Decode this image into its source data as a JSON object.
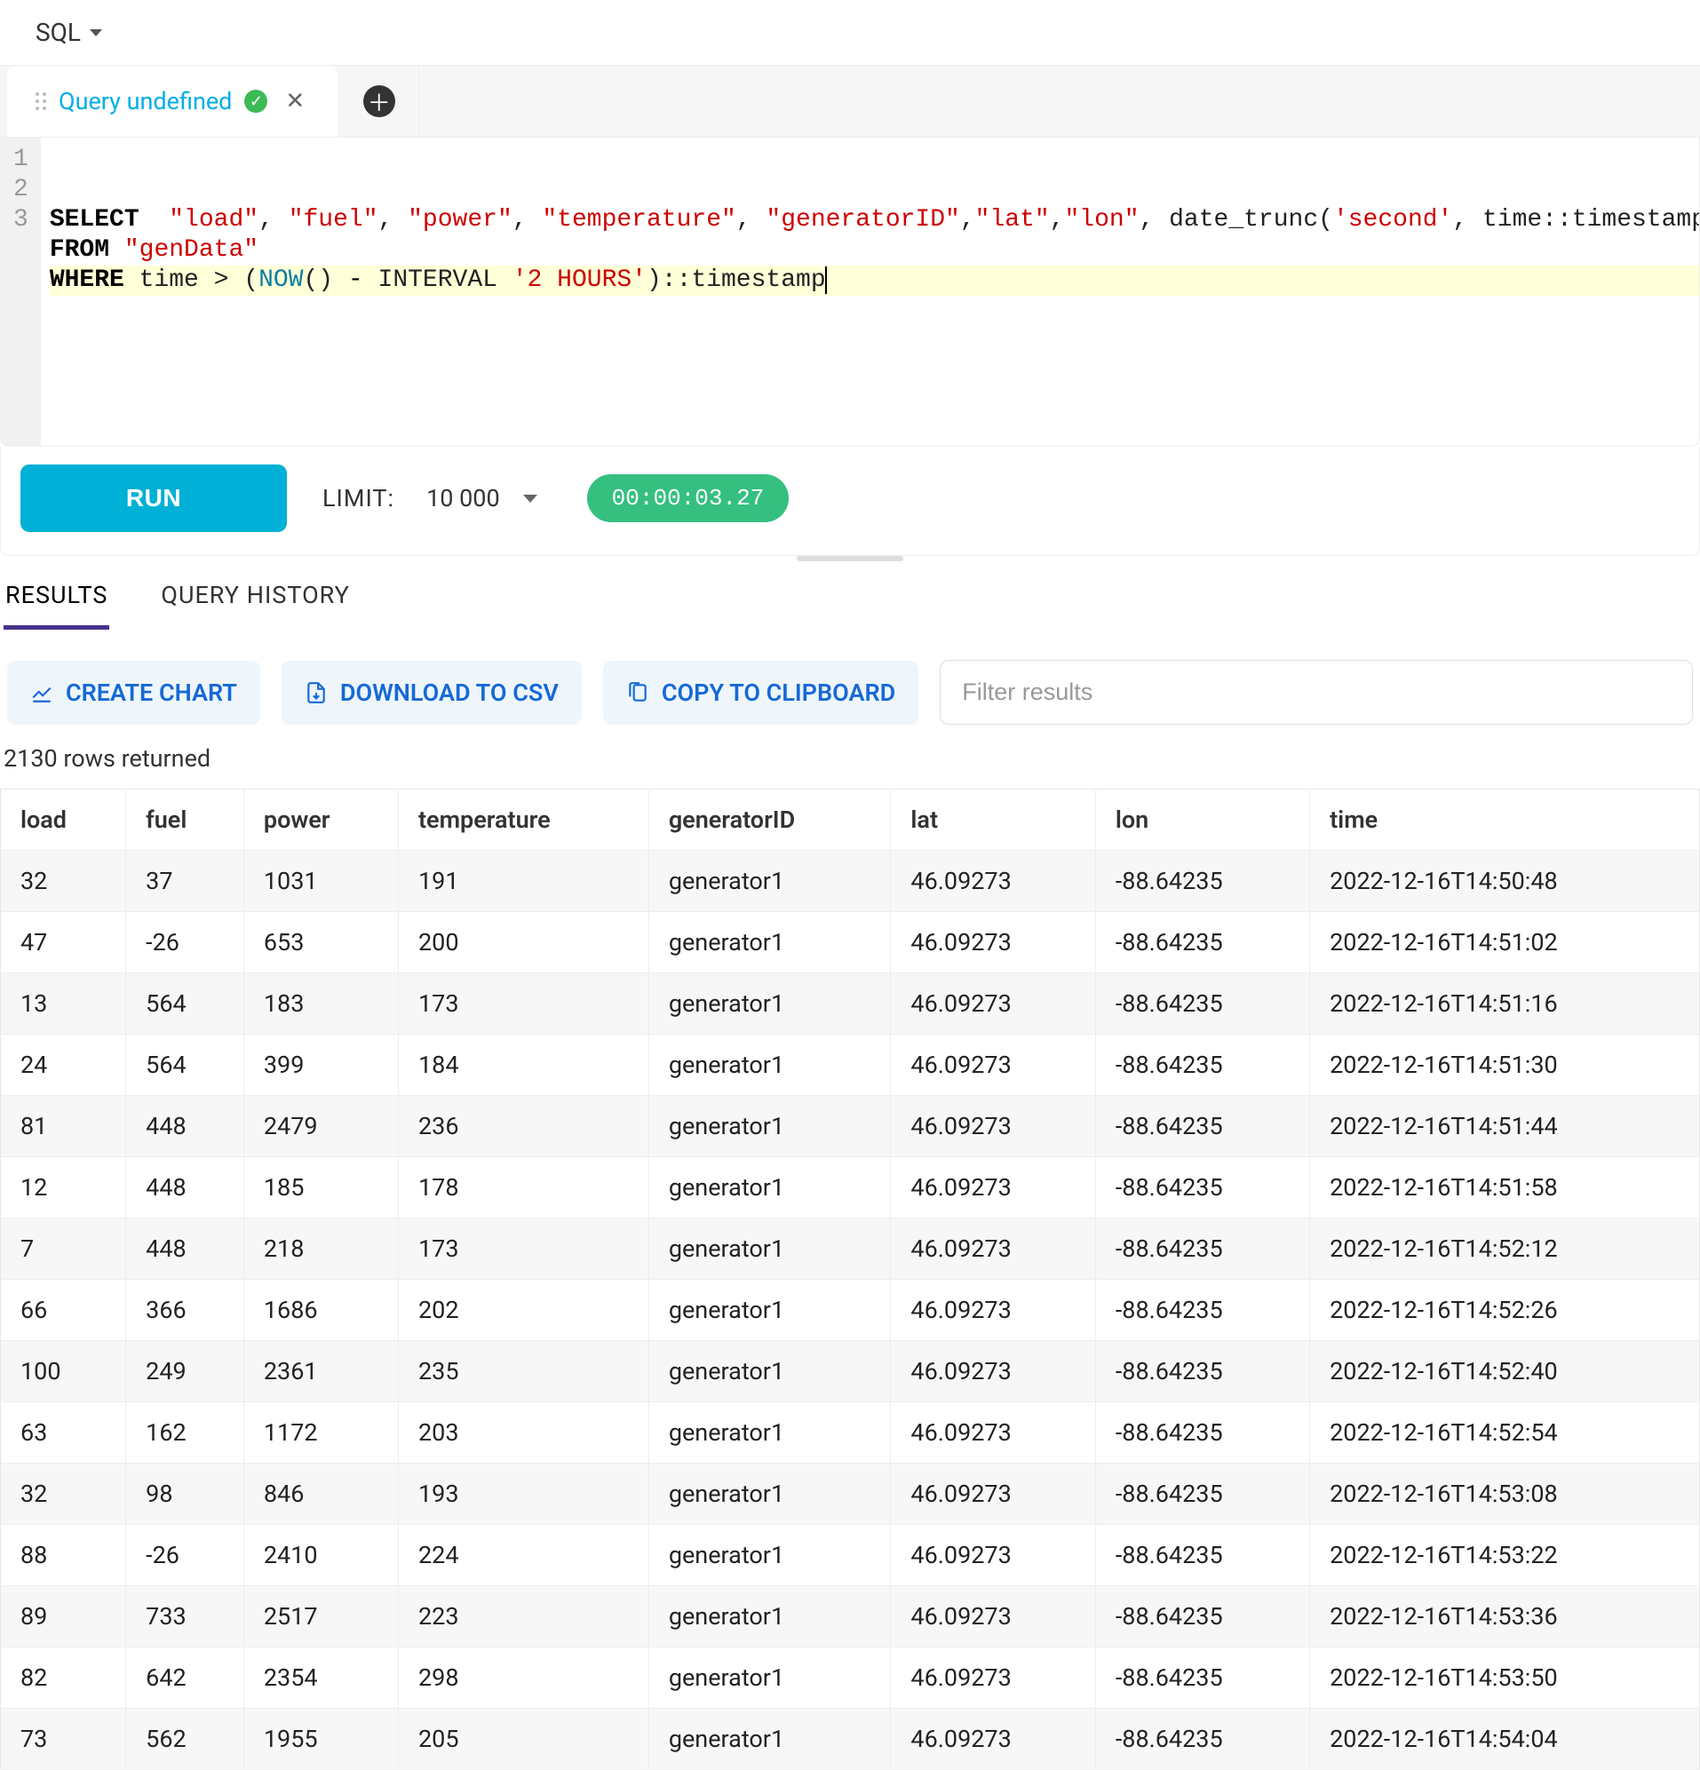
{
  "topbar": {
    "language": "SQL"
  },
  "tab": {
    "title": "Query undefined"
  },
  "editor": {
    "line_numbers": [
      "1",
      "2",
      "3"
    ],
    "lines_html": [
      "<span class='kw'>SELECT</span>  <span class='str'>\"load\"</span>, <span class='str'>\"fuel\"</span>, <span class='str'>\"power\"</span>, <span class='str'>\"temperature\"</span>, <span class='str'>\"generatorID\"</span>,<span class='str'>\"lat\"</span>,<span class='str'>\"lon\"</span>, date_trunc(<span class='lit'>'second'</span>, time::timestamp) <span class='kw'>as</span> <span class='str'>\"time\"</span>",
      "<span class='kw'>FROM</span> <span class='str'>\"genData\"</span>",
      "<span class='kw'>WHERE</span> time &gt; (<span class='fn'>NOW</span>() <span class='op'>-</span> INTERVAL <span class='lit'>'2 HOURS'</span>)::timestamp<span class='cursor'></span>"
    ],
    "highlighted_line_index": 2
  },
  "controls": {
    "run_label": "RUN",
    "limit_label": "LIMIT:",
    "limit_value": "10 000",
    "timer": "00:00:03.27"
  },
  "result_tabs": {
    "results": "RESULTS",
    "history": "QUERY HISTORY",
    "active": "results"
  },
  "actions": {
    "create_chart": "CREATE CHART",
    "download_csv": "DOWNLOAD TO CSV",
    "copy_clipboard": "COPY TO CLIPBOARD",
    "filter_placeholder": "Filter results"
  },
  "summary": {
    "rows_returned": "2130 rows returned"
  },
  "table": {
    "columns": [
      "load",
      "fuel",
      "power",
      "temperature",
      "generatorID",
      "lat",
      "lon",
      "time"
    ],
    "rows": [
      [
        "32",
        "37",
        "1031",
        "191",
        "generator1",
        "46.09273",
        "-88.64235",
        "2022-12-16T14:50:48"
      ],
      [
        "47",
        "-26",
        "653",
        "200",
        "generator1",
        "46.09273",
        "-88.64235",
        "2022-12-16T14:51:02"
      ],
      [
        "13",
        "564",
        "183",
        "173",
        "generator1",
        "46.09273",
        "-88.64235",
        "2022-12-16T14:51:16"
      ],
      [
        "24",
        "564",
        "399",
        "184",
        "generator1",
        "46.09273",
        "-88.64235",
        "2022-12-16T14:51:30"
      ],
      [
        "81",
        "448",
        "2479",
        "236",
        "generator1",
        "46.09273",
        "-88.64235",
        "2022-12-16T14:51:44"
      ],
      [
        "12",
        "448",
        "185",
        "178",
        "generator1",
        "46.09273",
        "-88.64235",
        "2022-12-16T14:51:58"
      ],
      [
        "7",
        "448",
        "218",
        "173",
        "generator1",
        "46.09273",
        "-88.64235",
        "2022-12-16T14:52:12"
      ],
      [
        "66",
        "366",
        "1686",
        "202",
        "generator1",
        "46.09273",
        "-88.64235",
        "2022-12-16T14:52:26"
      ],
      [
        "100",
        "249",
        "2361",
        "235",
        "generator1",
        "46.09273",
        "-88.64235",
        "2022-12-16T14:52:40"
      ],
      [
        "63",
        "162",
        "1172",
        "203",
        "generator1",
        "46.09273",
        "-88.64235",
        "2022-12-16T14:52:54"
      ],
      [
        "32",
        "98",
        "846",
        "193",
        "generator1",
        "46.09273",
        "-88.64235",
        "2022-12-16T14:53:08"
      ],
      [
        "88",
        "-26",
        "2410",
        "224",
        "generator1",
        "46.09273",
        "-88.64235",
        "2022-12-16T14:53:22"
      ],
      [
        "89",
        "733",
        "2517",
        "223",
        "generator1",
        "46.09273",
        "-88.64235",
        "2022-12-16T14:53:36"
      ],
      [
        "82",
        "642",
        "2354",
        "298",
        "generator1",
        "46.09273",
        "-88.64235",
        "2022-12-16T14:53:50"
      ],
      [
        "73",
        "562",
        "1955",
        "205",
        "generator1",
        "46.09273",
        "-88.64235",
        "2022-12-16T14:54:04"
      ]
    ]
  }
}
